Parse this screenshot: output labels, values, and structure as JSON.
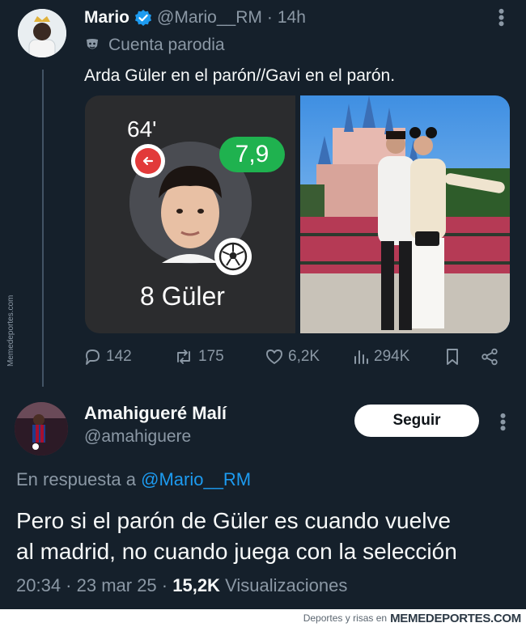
{
  "tweet": {
    "author_name": "Mario",
    "author_handle": "@Mario__RM",
    "dot": "·",
    "time": "14h",
    "parody_label": "Cuenta parodia",
    "text": "Arda Güler en el parón//Gavi en el parón.",
    "media": {
      "minute": "64'",
      "rating": "7,9",
      "player_label": "8 Güler"
    },
    "actions": {
      "replies": "142",
      "retweets": "175",
      "likes": "6,2K",
      "views": "294K"
    }
  },
  "side_watermark": "Memedeportes.com",
  "reply": {
    "author_name": "Amahigueré Malí",
    "author_handle": "@amahiguere",
    "follow_label": "Seguir",
    "reply_to_prefix": "En respuesta a",
    "reply_to_handle": "@Mario__RM",
    "text_line1": "Pero si el parón de Güler es cuando vuelve",
    "text_line2": "al madrid, no cuando juega con la selección",
    "time": "20:34 · 23 mar 25 ·",
    "views_count": "15,2K",
    "views_label": "Visualizaciones"
  },
  "footer": {
    "small": "Deportes y risas en",
    "brand": "MEMEDEPORTES.COM"
  },
  "colors": {
    "background": "#15202b",
    "muted": "#8b98a5",
    "link": "#1d9bf0",
    "verified": "#1d9bf0",
    "rating_green": "#1fb24f",
    "sub_red": "#e23a3a"
  }
}
